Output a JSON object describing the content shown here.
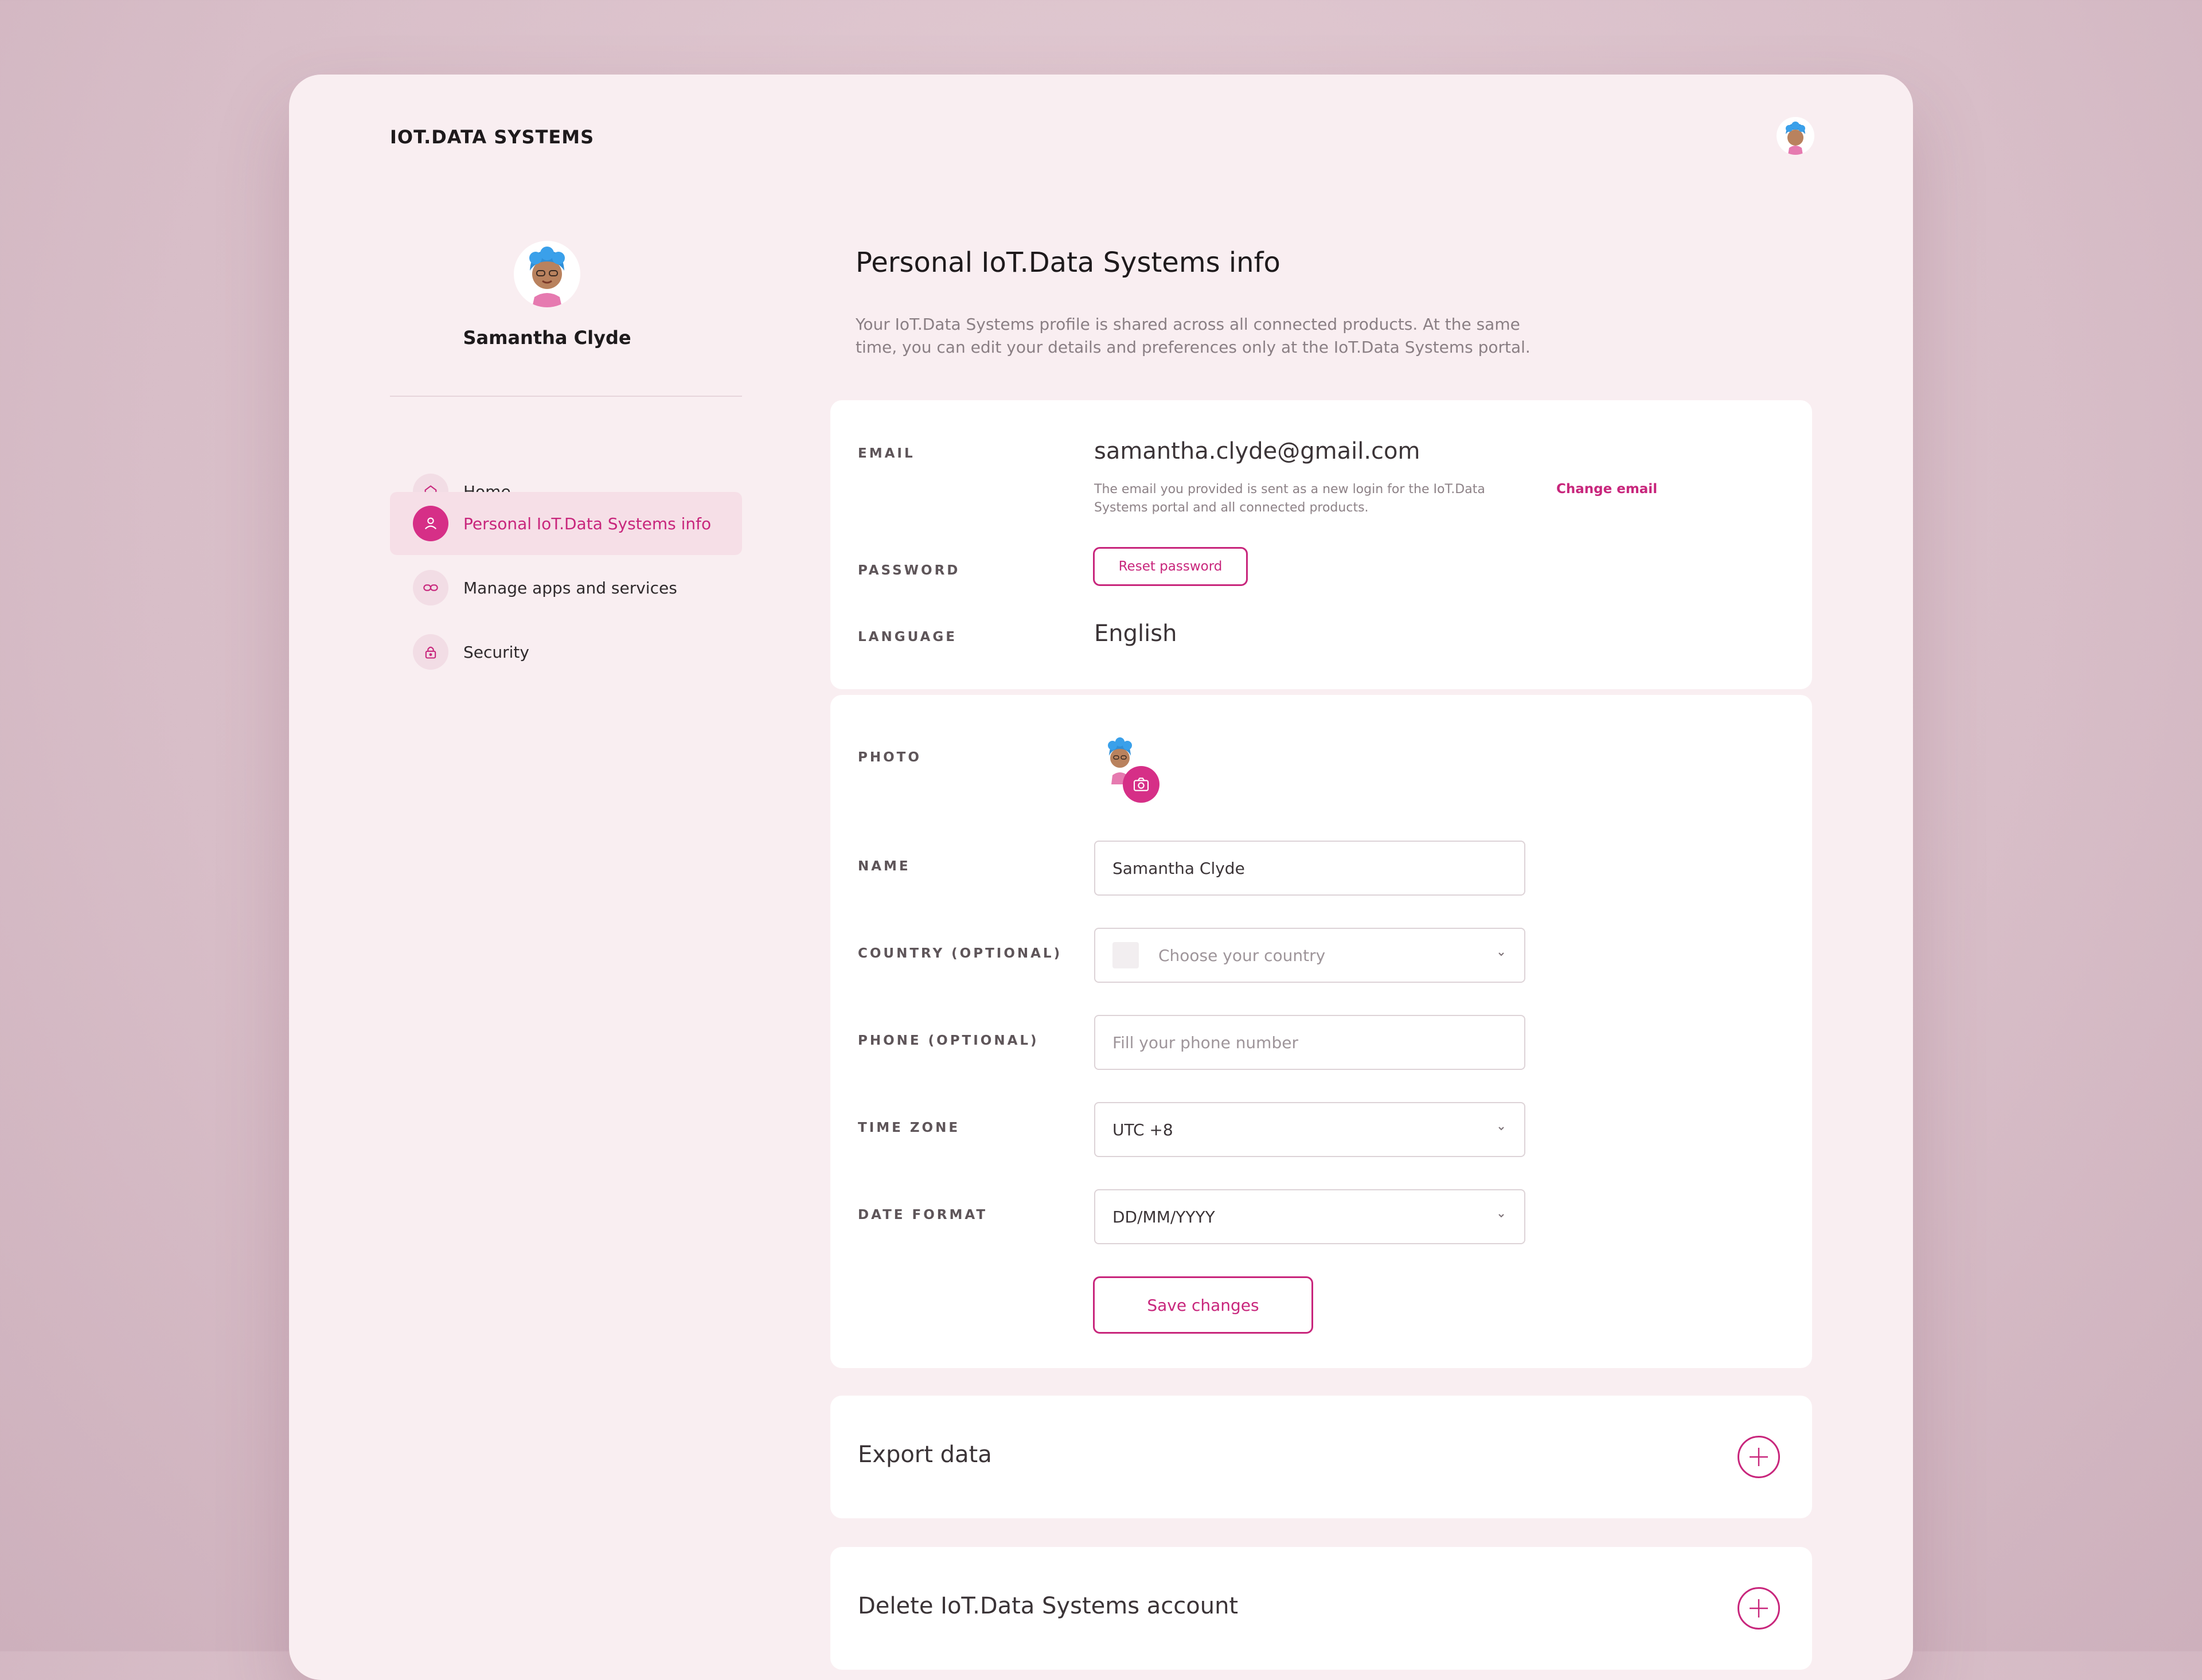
{
  "header": {
    "brand": "IOT.DATA SYSTEMS"
  },
  "sidebar": {
    "user_name": "Samantha Clyde",
    "items": [
      {
        "label": "Home",
        "icon": "home-icon"
      },
      {
        "label": "Personal IoT.Data Systems info",
        "icon": "user-icon",
        "active": true
      },
      {
        "label": "Manage apps and services",
        "icon": "link-icon"
      },
      {
        "label": "Security",
        "icon": "lock-icon"
      }
    ]
  },
  "main": {
    "title": "Personal IoT.Data Systems info",
    "description": "Your IoT.Data Systems profile is shared across all connected products. At the same time, you can edit your details and preferences only at the IoT.Data Systems portal.",
    "account": {
      "email_label": "EMAIL",
      "email_value": "samantha.clyde@gmail.com",
      "email_help": "The email you provided is sent as a new login for the IoT.Data Systems portal and all connected products.",
      "change_email": "Change email",
      "password_label": "PASSWORD",
      "reset_password": "Reset password",
      "language_label": "LANGUAGE",
      "language_value": "English"
    },
    "profile": {
      "photo_label": "PHOTO",
      "name_label": "NAME",
      "name_value": "Samantha Clyde",
      "country_label": "COUNTRY (OPTIONAL)",
      "country_placeholder": "Choose your country",
      "phone_label": "PHONE (OPTIONAL)",
      "phone_placeholder": "Fill your phone number",
      "timezone_label": "TIME ZONE",
      "timezone_value": "UTC +8",
      "dateformat_label": "DATE FORMAT",
      "dateformat_value": "DD/MM/YYYY",
      "save_label": "Save changes"
    },
    "export": {
      "title": "Export data"
    },
    "delete": {
      "title": "Delete IoT.Data Systems account"
    }
  },
  "colors": {
    "accent": "#c8267c",
    "window_bg": "#f9eef1",
    "page_bg": "#dcc4cd"
  }
}
